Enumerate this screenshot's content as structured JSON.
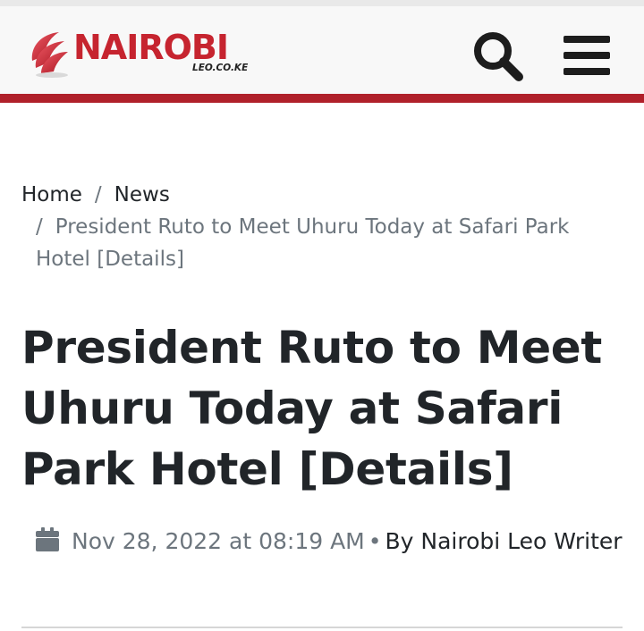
{
  "header": {
    "logo_text": "NAIROBI",
    "logo_subtext": "LEO.CO.KE",
    "search_icon": "search-icon",
    "menu_icon": "hamburger-menu-icon",
    "brand_color": "#c6242f",
    "accent_bar_color": "#b0202a"
  },
  "breadcrumb": {
    "separator": "/",
    "home": "Home",
    "news": "News",
    "current": "President Ruto to Meet Uhuru Today at Safari Park Hotel [Details]"
  },
  "article": {
    "title": "President Ruto to Meet Uhuru Today at Safari Park Hotel [Details]",
    "date_icon": "calendar-icon",
    "date": "Nov 28, 2022 at 08:19 AM",
    "bullet": "•",
    "byline": "By Nairobi Leo Writer"
  }
}
